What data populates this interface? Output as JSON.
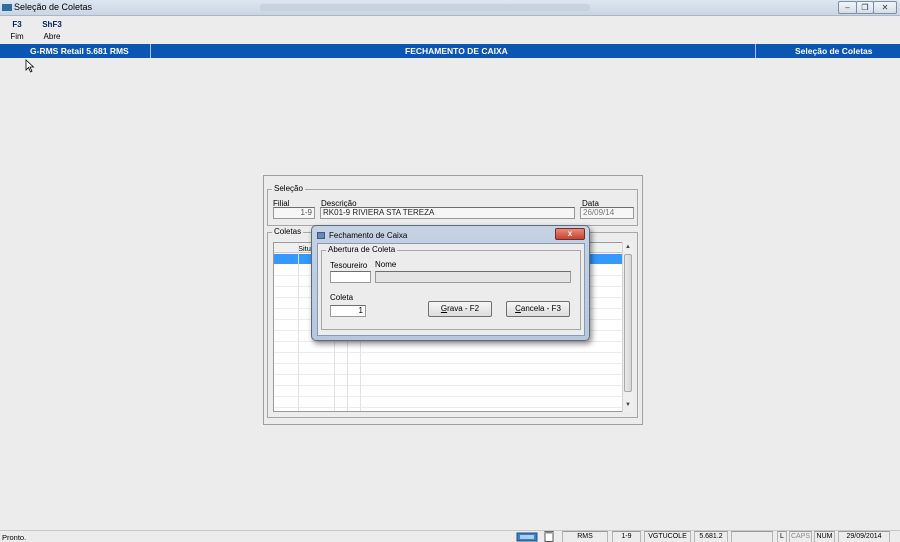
{
  "window": {
    "title": "Seleção de Coletas",
    "blurred_title": "",
    "minimize_icon": "minimize-icon",
    "restore_icon": "restore-icon",
    "close_icon": "close-icon"
  },
  "toolbar": [
    {
      "key": "F3",
      "label": "Fim"
    },
    {
      "key": "ShF3",
      "label": "Abre"
    }
  ],
  "header": {
    "app": "G-RMS Retail 5.681 RMS",
    "center": "FECHAMENTO DE CAIXA",
    "right": "Seleção de Coletas"
  },
  "selecao": {
    "legend": "Seleção",
    "filial_label": "Filial",
    "filial_value": "1-9",
    "descricao_label": "Descrição",
    "descricao_value": "RK01-9 RIVIERA STA TEREZA",
    "data_label": "Data",
    "data_value": "26/09/14"
  },
  "coletas": {
    "legend": "Coletas",
    "column_header": "Situ"
  },
  "dialog": {
    "title": "Fechamento de Caixa",
    "close_glyph": "x",
    "group_legend": "Abertura de Coleta",
    "tesoureiro_label": "Tesoureiro",
    "nome_label": "Nome",
    "tesoureiro_value": "",
    "nome_value": "",
    "coleta_label": "Coleta",
    "coleta_value": "1",
    "grava_label": "Grava - F2",
    "cancela_label": "Cancela - F3"
  },
  "statusbar": {
    "status": "Pronto.",
    "fields": [
      "RMS",
      "1-9",
      "VGTUCOLE",
      "5.681.2",
      "",
      "L",
      "CAPS",
      "NUM",
      "29/09/2014"
    ]
  }
}
